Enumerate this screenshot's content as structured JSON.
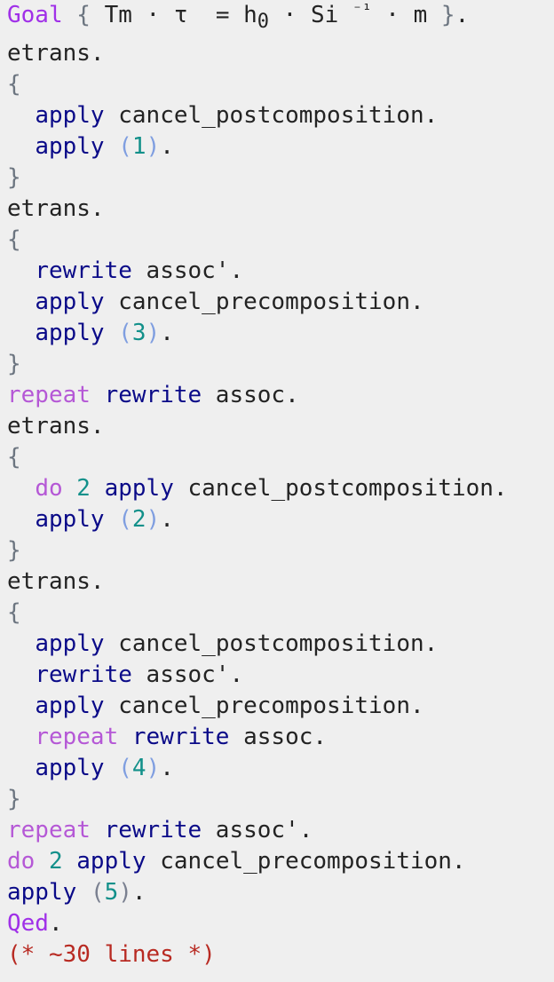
{
  "colors": {
    "keyword": "#a030e8",
    "tactical": "#b558d6",
    "tactic": "#0a0a88",
    "number": "#12908a",
    "comment": "#b82a22",
    "background": "#efefef"
  },
  "lines": [
    [
      {
        "t": "Goal",
        "c": "kw"
      },
      {
        "t": " "
      },
      {
        "t": "{",
        "c": "brace"
      },
      {
        "t": " Tm · τ  = h"
      },
      {
        "t": "0",
        "c": "sub"
      },
      {
        "t": " · Si "
      },
      {
        "t": "⁻¹",
        "c": "sup"
      },
      {
        "t": " · m "
      },
      {
        "t": "}",
        "c": "brace"
      },
      {
        "t": "."
      }
    ],
    [
      {
        "t": "etrans."
      }
    ],
    [
      {
        "t": "{",
        "c": "brace"
      }
    ],
    [
      {
        "t": "  "
      },
      {
        "t": "apply",
        "c": "tac"
      },
      {
        "t": " cancel_postcomposition."
      }
    ],
    [
      {
        "t": "  "
      },
      {
        "t": "apply",
        "c": "tac"
      },
      {
        "t": " "
      },
      {
        "t": "(",
        "c": "paren"
      },
      {
        "t": "1",
        "c": "num"
      },
      {
        "t": ")",
        "c": "paren"
      },
      {
        "t": "."
      }
    ],
    [
      {
        "t": "}",
        "c": "brace"
      }
    ],
    [
      {
        "t": "etrans."
      }
    ],
    [
      {
        "t": "{",
        "c": "brace"
      }
    ],
    [
      {
        "t": "  "
      },
      {
        "t": "rewrite",
        "c": "tac"
      },
      {
        "t": " assoc'."
      }
    ],
    [
      {
        "t": "  "
      },
      {
        "t": "apply",
        "c": "tac"
      },
      {
        "t": " cancel_precomposition."
      }
    ],
    [
      {
        "t": "  "
      },
      {
        "t": "apply",
        "c": "tac"
      },
      {
        "t": " "
      },
      {
        "t": "(",
        "c": "paren"
      },
      {
        "t": "3",
        "c": "num"
      },
      {
        "t": ")",
        "c": "paren"
      },
      {
        "t": "."
      }
    ],
    [
      {
        "t": "}",
        "c": "brace"
      }
    ],
    [
      {
        "t": "repeat",
        "c": "kw2"
      },
      {
        "t": " "
      },
      {
        "t": "rewrite",
        "c": "tac"
      },
      {
        "t": " assoc."
      }
    ],
    [
      {
        "t": "etrans."
      }
    ],
    [
      {
        "t": "{",
        "c": "brace"
      }
    ],
    [
      {
        "t": "  "
      },
      {
        "t": "do",
        "c": "kw2"
      },
      {
        "t": " "
      },
      {
        "t": "2",
        "c": "num"
      },
      {
        "t": " "
      },
      {
        "t": "apply",
        "c": "tac"
      },
      {
        "t": " cancel_postcomposition."
      }
    ],
    [
      {
        "t": "  "
      },
      {
        "t": "apply",
        "c": "tac"
      },
      {
        "t": " "
      },
      {
        "t": "(",
        "c": "paren"
      },
      {
        "t": "2",
        "c": "num"
      },
      {
        "t": ")",
        "c": "paren"
      },
      {
        "t": "."
      }
    ],
    [
      {
        "t": "}",
        "c": "brace"
      }
    ],
    [
      {
        "t": "etrans."
      }
    ],
    [
      {
        "t": "{",
        "c": "brace"
      }
    ],
    [
      {
        "t": "  "
      },
      {
        "t": "apply",
        "c": "tac"
      },
      {
        "t": " cancel_postcomposition."
      }
    ],
    [
      {
        "t": "  "
      },
      {
        "t": "rewrite",
        "c": "tac"
      },
      {
        "t": " assoc'."
      }
    ],
    [
      {
        "t": "  "
      },
      {
        "t": "apply",
        "c": "tac"
      },
      {
        "t": " cancel_precomposition."
      }
    ],
    [
      {
        "t": "  "
      },
      {
        "t": "repeat",
        "c": "kw2"
      },
      {
        "t": " "
      },
      {
        "t": "rewrite",
        "c": "tac"
      },
      {
        "t": " assoc."
      }
    ],
    [
      {
        "t": "  "
      },
      {
        "t": "apply",
        "c": "tac"
      },
      {
        "t": " "
      },
      {
        "t": "(",
        "c": "paren"
      },
      {
        "t": "4",
        "c": "num"
      },
      {
        "t": ")",
        "c": "paren"
      },
      {
        "t": "."
      }
    ],
    [
      {
        "t": "}",
        "c": "brace"
      }
    ],
    [
      {
        "t": "repeat",
        "c": "kw2"
      },
      {
        "t": " "
      },
      {
        "t": "rewrite",
        "c": "tac"
      },
      {
        "t": " assoc'."
      }
    ],
    [
      {
        "t": "do",
        "c": "kw2"
      },
      {
        "t": " "
      },
      {
        "t": "2",
        "c": "num"
      },
      {
        "t": " "
      },
      {
        "t": "apply",
        "c": "tac"
      },
      {
        "t": " cancel_precomposition."
      }
    ],
    [
      {
        "t": "apply",
        "c": "tac"
      },
      {
        "t": " "
      },
      {
        "t": "(",
        "c": "paren2"
      },
      {
        "t": "5",
        "c": "num"
      },
      {
        "t": ")",
        "c": "paren2"
      },
      {
        "t": "."
      }
    ],
    [
      {
        "t": "Qed",
        "c": "kw"
      },
      {
        "t": "."
      }
    ],
    [
      {
        "t": "(* ~30 lines *)",
        "c": "cmt"
      }
    ]
  ]
}
